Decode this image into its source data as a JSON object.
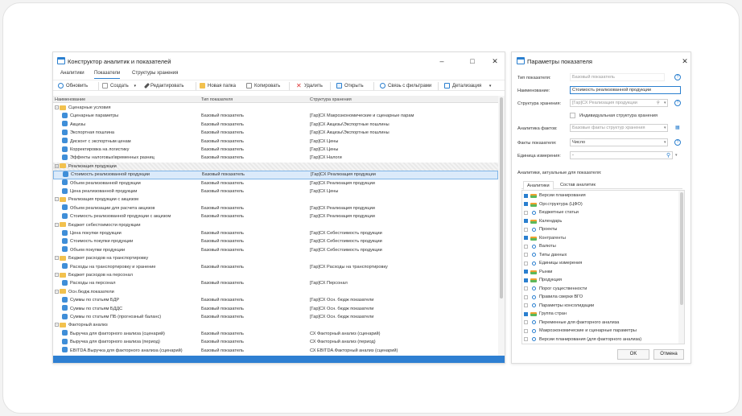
{
  "main_window": {
    "title": "Конструктор аналитик и показателей",
    "tabs": [
      "Аналитики",
      "Показатели",
      "Структуры хранения"
    ],
    "toolbar": [
      "Обновить",
      "Создать",
      "Редактировать",
      "Новая папка",
      "Копировать",
      "Удалить",
      "Открыть",
      "Связь с фильтрами",
      "Детализация"
    ],
    "columns": [
      "Наименование",
      "Тип показателя",
      "Структура хранения"
    ],
    "rows": [
      {
        "t": "g",
        "n": "Сценарные условия"
      },
      {
        "t": "i",
        "n": "Сценарные параметры",
        "k": "Базовый показатель",
        "s": "[Гар]СХ Макроэкономические и сценарные парам"
      },
      {
        "t": "i",
        "n": "Акцизы",
        "k": "Базовый показатель",
        "s": "[Гар]СХ Акцизы\\Экспортные пошлины"
      },
      {
        "t": "i",
        "n": "Экспортная пошлина",
        "k": "Базовый показатель",
        "s": "[Гар]СХ Акцизы\\Экспортные пошлины"
      },
      {
        "t": "i",
        "n": "Дисконт с экспортным ценам",
        "k": "Базовый показатель",
        "s": "[Гар]СХ Цены"
      },
      {
        "t": "i",
        "n": "Корректировка на логистику",
        "k": "Базовый показатель",
        "s": "[Гар]СХ Цены"
      },
      {
        "t": "i",
        "n": "Эффекты налоговых\\временных разниц",
        "k": "Базовый показатель",
        "s": "[Гар]СХ Налоги"
      },
      {
        "t": "g",
        "n": "Реализация продукции",
        "hatch": true
      },
      {
        "t": "i",
        "n": "Стоимость реализованной продукции",
        "k": "Базовый показатель",
        "s": "[Гар]СХ Реализация продукции",
        "sel": true
      },
      {
        "t": "i",
        "n": "Объем реализованной продукции",
        "k": "Базовый показатель",
        "s": "[Гар]СХ Реализация продукции"
      },
      {
        "t": "i",
        "n": "Цена реализованной продукции",
        "k": "Базовый показатель",
        "s": "[Гар]СХ Цены"
      },
      {
        "t": "g",
        "n": "Реализация продукции с акцизом"
      },
      {
        "t": "i",
        "n": "Объем реализации для расчета акцизов",
        "k": "Базовый показатель",
        "s": "[Гар]СХ Реализация продукции"
      },
      {
        "t": "i",
        "n": "Стоимость реализованной продукции с акцизом",
        "k": "Базовый показатель",
        "s": "[Гар]СХ Реализация продукции"
      },
      {
        "t": "g",
        "n": "Бюджет себестоимости продукции"
      },
      {
        "t": "i",
        "n": "Цена покупки продукции",
        "k": "Базовый показатель",
        "s": "[Гар]СХ Себестоимость продукции"
      },
      {
        "t": "i",
        "n": "Стоимость покупки продукции",
        "k": "Базовый показатель",
        "s": "[Гар]СХ Себестоимость продукции"
      },
      {
        "t": "i",
        "n": "Объем покупки продукции",
        "k": "Базовый показатель",
        "s": "[Гар]СХ Себестоимость продукции"
      },
      {
        "t": "g",
        "n": "Бюджет расходов на транспортировку"
      },
      {
        "t": "i",
        "n": "Расходы на транспортировку и хранение",
        "k": "Базовый показатель",
        "s": "[Гар]СХ Расходы на транспортировку"
      },
      {
        "t": "g",
        "n": "Бюджет расходов на персонал"
      },
      {
        "t": "i",
        "n": "Расходы на персонал",
        "k": "Базовый показатель",
        "s": "[Гар]СХ Персонал"
      },
      {
        "t": "g",
        "n": "Осн.бюдж.показатели"
      },
      {
        "t": "i",
        "n": "Суммы по статьям БДР",
        "k": "Базовый показатель",
        "s": "[Гар]СХ Осн. бюдж показатели"
      },
      {
        "t": "i",
        "n": "Суммы по статьям БДДС",
        "k": "Базовый показатель",
        "s": "[Гар]СХ Осн. бюдж показатели"
      },
      {
        "t": "i",
        "n": "Суммы по статьям ПБ (прогнозный баланс)",
        "k": "Базовый показатель",
        "s": "[Гар]СХ Осн. бюдж показатели"
      },
      {
        "t": "g",
        "n": "Факторный анализ"
      },
      {
        "t": "i",
        "n": "Выручка для факторного анализа (сценарий)",
        "k": "Базовый показатель",
        "s": "СХ Факторный анализ (сценарий)"
      },
      {
        "t": "i",
        "n": "Выручка для факторного анализа (период)",
        "k": "Базовый показатель",
        "s": "СХ Факторный анализ (период)"
      },
      {
        "t": "i",
        "n": "EBITDA.Выручка для факторного анализа (сценарий)",
        "k": "Базовый показатель",
        "s": "СХ EBITDA.Факторный анализ (сценарий)"
      }
    ]
  },
  "params_window": {
    "title": "Параметры показателя",
    "type_label": "Тип показателя:",
    "type_value": "Базовый показатель",
    "name_label": "Наименование:",
    "name_value": "Стоимость реализованной продукции",
    "struct_label": "Структура хранения:",
    "struct_value": "[Гар]СХ Реализация продукции",
    "individual_label": "Индивидуальная структура хранения",
    "facts_an_label": "Аналитика фактов:",
    "facts_an_value": "Базовые факты структур хранения",
    "facts_label": "Факты показателя:",
    "facts_value": "Число",
    "unit_label": "Единица измерения:",
    "unit_value": "-",
    "analytics_title": "Аналитики, актуальные для показателя:",
    "tabs": [
      "Аналитики",
      "Состав аналитик"
    ],
    "items": [
      {
        "n": "Версии планирования",
        "c": true,
        "k": "h"
      },
      {
        "n": "Орг.структура (ЦФО)",
        "c": true,
        "k": "h"
      },
      {
        "n": "Бюджетные статьи",
        "c": false,
        "k": "r"
      },
      {
        "n": "Календарь",
        "c": true,
        "k": "h"
      },
      {
        "n": "Проекты",
        "c": false,
        "k": "r"
      },
      {
        "n": "Контрагенты",
        "c": true,
        "k": "h"
      },
      {
        "n": "Валюты",
        "c": false,
        "k": "r"
      },
      {
        "n": "Типы данных",
        "c": false,
        "k": "r"
      },
      {
        "n": "Единицы измерения",
        "c": false,
        "k": "r"
      },
      {
        "n": "Рынки",
        "c": true,
        "k": "h"
      },
      {
        "n": "Продукция",
        "c": true,
        "k": "h"
      },
      {
        "n": "Порог существенности",
        "c": false,
        "k": "r"
      },
      {
        "n": "Правила сверки ВГО",
        "c": false,
        "k": "r"
      },
      {
        "n": "Параметры консолидации",
        "c": false,
        "k": "r"
      },
      {
        "n": "Группа стран",
        "c": true,
        "k": "h"
      },
      {
        "n": "Переменные для факторного анализа",
        "c": false,
        "k": "r"
      },
      {
        "n": "Макроэкономические и сценарные параметры",
        "c": false,
        "k": "r"
      },
      {
        "n": "Версии планирования (для факторного анализа)",
        "c": false,
        "k": "r"
      }
    ],
    "ok": "OK",
    "cancel": "Отмена"
  }
}
